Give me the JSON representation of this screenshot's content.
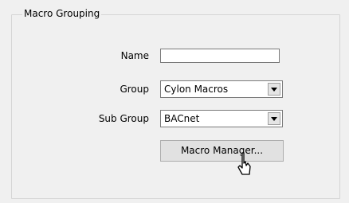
{
  "group": {
    "title": "Macro Grouping"
  },
  "fields": {
    "name_label": "Name",
    "name_value": "",
    "group_label": "Group",
    "group_value": "Cylon Macros",
    "subgroup_label": "Sub Group",
    "subgroup_value": "BACnet"
  },
  "actions": {
    "macro_manager_label": "Macro Manager..."
  },
  "icons": {
    "dropdown": "chevron-down-icon",
    "cursor": "cursor-icon"
  }
}
